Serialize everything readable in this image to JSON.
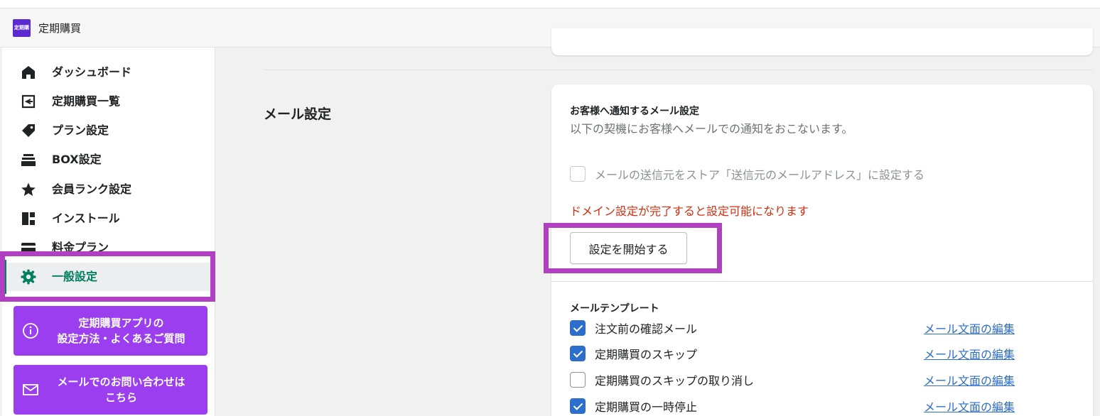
{
  "app": {
    "title": "定期購買",
    "logo_text": "定期購買"
  },
  "sidebar": {
    "items": [
      {
        "label": "ダッシュボード",
        "icon": "home-icon"
      },
      {
        "label": "定期購買一覧",
        "icon": "subscription-list-icon"
      },
      {
        "label": "プラン設定",
        "icon": "tag-icon"
      },
      {
        "label": "BOX設定",
        "icon": "box-stack-icon"
      },
      {
        "label": "会員ランク設定",
        "icon": "star-icon"
      },
      {
        "label": "インストール",
        "icon": "apps-icon"
      },
      {
        "label": "料金プラン",
        "icon": "credit-card-icon"
      },
      {
        "label": "一般設定",
        "icon": "gear-icon",
        "active": true
      }
    ],
    "help_button": {
      "line1": "定期購買アプリの",
      "line2": "設定方法・よくあるご質問",
      "icon": "info-icon"
    },
    "contact_button": {
      "line1": "メールでのお問い合わせは",
      "line2": "こちら",
      "icon": "mail-icon"
    }
  },
  "main": {
    "section_title": "メール設定",
    "card": {
      "heading": "お客様へ通知するメール設定",
      "description": "以下の契機にお客様へメールでの通知をおこないます。",
      "sender_checkbox": {
        "label": "メールの送信元をストア「送信元のメールアドレス」に設定する",
        "checked": false,
        "disabled": true
      },
      "warning": "ドメイン設定が完了すると設定可能になります",
      "start_button": "設定を開始する",
      "templates_heading": "メールテンプレート",
      "templates": [
        {
          "label": "注文前の確認メール",
          "checked": true,
          "link": "メール文面の編集"
        },
        {
          "label": "定期購買のスキップ",
          "checked": true,
          "link": "メール文面の編集"
        },
        {
          "label": "定期購買のスキップの取り消し",
          "checked": false,
          "link": "メール文面の編集"
        },
        {
          "label": "定期購買の一時停止",
          "checked": true,
          "link": "メール文面の編集"
        }
      ]
    }
  },
  "colors": {
    "accent_purple": "#9b3ef0",
    "highlight": "#b03fc1",
    "active_green": "#007f5f",
    "link_blue": "#2c6ecb",
    "warning_red": "#d82c0d"
  }
}
